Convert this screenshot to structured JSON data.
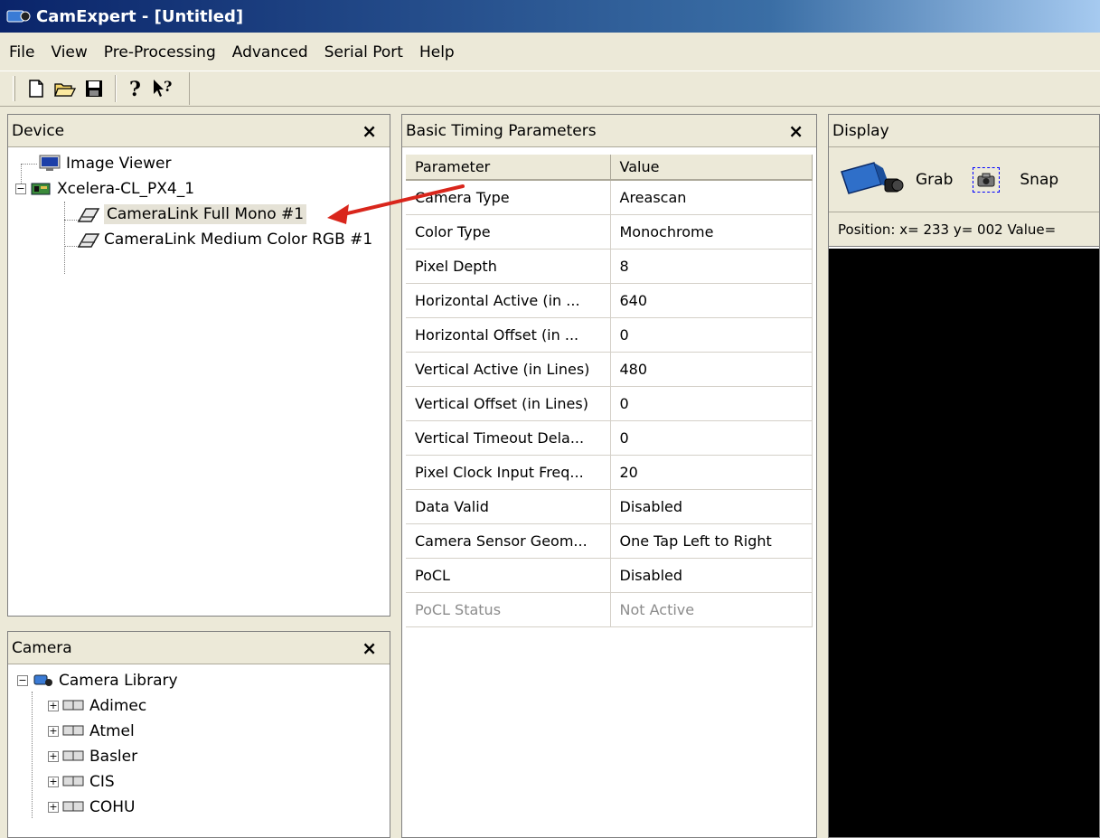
{
  "window": {
    "title": "CamExpert - [Untitled]"
  },
  "menu": [
    "File",
    "View",
    "Pre-Processing",
    "Advanced",
    "Serial Port",
    "Help"
  ],
  "toolbar": {
    "icons": [
      "new-file-icon",
      "open-folder-icon",
      "save-icon",
      "help-icon",
      "context-help-icon"
    ]
  },
  "device_pane": {
    "title": "Device",
    "close": "×",
    "items": [
      {
        "label": "Image Viewer",
        "icon": "monitor-icon"
      },
      {
        "label": "Xcelera-CL_PX4_1",
        "icon": "board-icon"
      },
      {
        "label": "CameraLink Full Mono #1",
        "icon": "cable-icon"
      },
      {
        "label": "CameraLink Medium Color RGB #1",
        "icon": "cable-icon"
      }
    ],
    "expander": "−"
  },
  "camera_pane": {
    "title": "Camera",
    "close": "×",
    "root": "Camera Library",
    "expander_root": "−",
    "expander_child": "+",
    "vendors": [
      "Adimec",
      "Atmel",
      "Basler",
      "CIS",
      "COHU"
    ]
  },
  "timing_pane": {
    "title": "Basic Timing Parameters",
    "close": "×",
    "headers": [
      "Parameter",
      "Value"
    ],
    "rows": [
      [
        "Camera Type",
        "Areascan"
      ],
      [
        "Color Type",
        "Monochrome"
      ],
      [
        "Pixel Depth",
        "8"
      ],
      [
        "Horizontal Active (in ...",
        "640"
      ],
      [
        "Horizontal Offset (in ...",
        "0"
      ],
      [
        "Vertical Active (in Lines)",
        "480"
      ],
      [
        "Vertical Offset (in Lines)",
        "0"
      ],
      [
        "Vertical Timeout Dela...",
        "0"
      ],
      [
        "Pixel Clock Input Freq...",
        "20"
      ],
      [
        "Data Valid",
        "Disabled"
      ],
      [
        "Camera Sensor Geom...",
        "One Tap Left to Right"
      ],
      [
        "PoCL",
        "Disabled"
      ],
      [
        "PoCL Status",
        "Not Active"
      ]
    ]
  },
  "display_pane": {
    "title": "Display",
    "grab_label": "Grab",
    "snap_label": "Snap",
    "position_text": "Position:  x= 233 y= 002 Value="
  },
  "colors": {
    "annotation_arrow": "#d9261c",
    "title_gradient_start": "#0a246a"
  }
}
